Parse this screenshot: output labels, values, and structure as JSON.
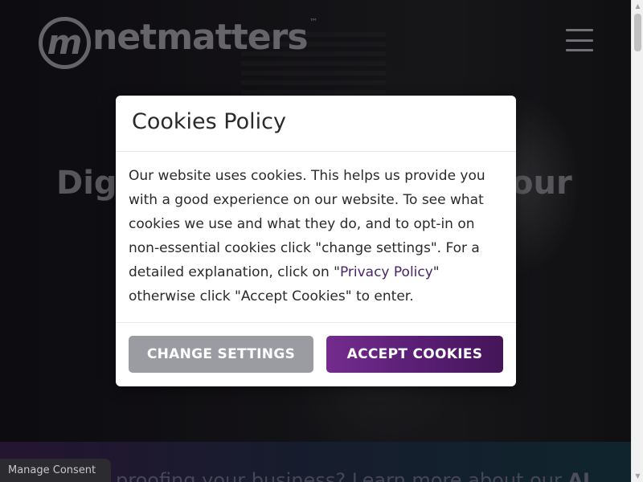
{
  "header": {
    "logo_mark": "m",
    "logo_text": "netmatters",
    "logo_tm": "™"
  },
  "hero": {
    "heading_left": "Digi",
    "heading_right": "our"
  },
  "banner": {
    "text_prefix": "proofing your business? Learn more about our ",
    "text_bold": "AI"
  },
  "cookie_modal": {
    "title": "Cookies Policy",
    "body_part1": "Our website uses cookies. This helps us provide you with a good experience on our website. To see what cookies we use and what they do, and to opt-in on non-essential cookies click \"change settings\". For a detailed explanation, click on \"",
    "body_link": "Privacy Policy",
    "body_part2": "\" otherwise click \"Accept Cookies\" to enter.",
    "change_settings_label": "CHANGE SETTINGS",
    "accept_label": "ACCEPT COOKIES"
  },
  "manage_consent_label": "Manage Consent",
  "colors": {
    "accept_button": "#5a1f76",
    "settings_button": "#9b9ca2",
    "link": "#4a2468"
  }
}
